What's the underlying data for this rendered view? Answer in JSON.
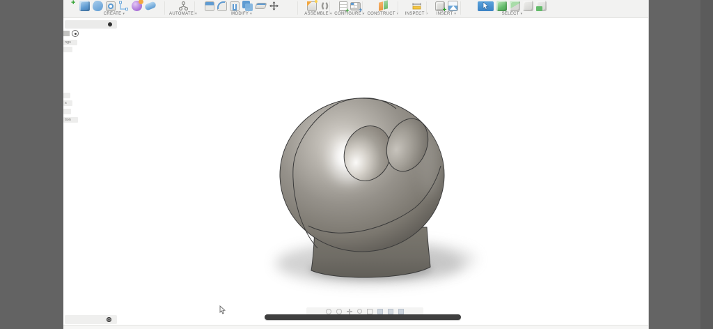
{
  "colors": {
    "letterbox": "#636363",
    "toolbar_bg": "#f2f2f1",
    "canvas_bg": "#ffffff",
    "accent_blue": "#3b82c4",
    "select_green": "#63bb6a",
    "scrubber": "#3f3f3f",
    "model_base_gray": "#8a867f"
  },
  "toolbar": {
    "caret": "▾",
    "groups": [
      {
        "label": "CREATE",
        "icons": [
          "new-plus",
          "solid-box",
          "form-blob",
          "hole",
          "sketch",
          "form-sphere",
          "pipe"
        ]
      },
      {
        "label": "AUTOMATE",
        "icons": [
          "script"
        ]
      },
      {
        "label": "MODIFY",
        "icons": [
          "press-pull",
          "fillet",
          "shell",
          "combine",
          "offset-face",
          "move"
        ]
      },
      {
        "label": "ASSEMBLE",
        "icons": [
          "new-component",
          "joint"
        ]
      },
      {
        "label": "CONFIGURE",
        "icons": [
          "configuration",
          "configuration-table"
        ]
      },
      {
        "label": "CONSTRUCT",
        "icons": [
          "offset-plane"
        ]
      },
      {
        "label": "INSPECT",
        "icons": [
          "measure"
        ]
      },
      {
        "label": "INSERT",
        "icons": [
          "derive",
          "canvas"
        ]
      },
      {
        "label": "SELECT",
        "icons": [
          "select-active",
          "select-body",
          "select-face",
          "select-edge",
          "select-component"
        ]
      }
    ]
  },
  "browser": {
    "fragments": [
      {
        "text": "ngs"
      },
      {
        "text": ""
      },
      {
        "text": ""
      },
      {
        "text": "s"
      },
      {
        "text": ""
      },
      {
        "text": "tion"
      }
    ]
  },
  "viewport": {
    "model": "gray sphere head with two sketched eye ellipses on a cylindrical base"
  },
  "navbar": {
    "icons": [
      "orbit",
      "look-at",
      "pan",
      "zoom",
      "fit",
      "display-settings",
      "grid",
      "viewports"
    ]
  }
}
